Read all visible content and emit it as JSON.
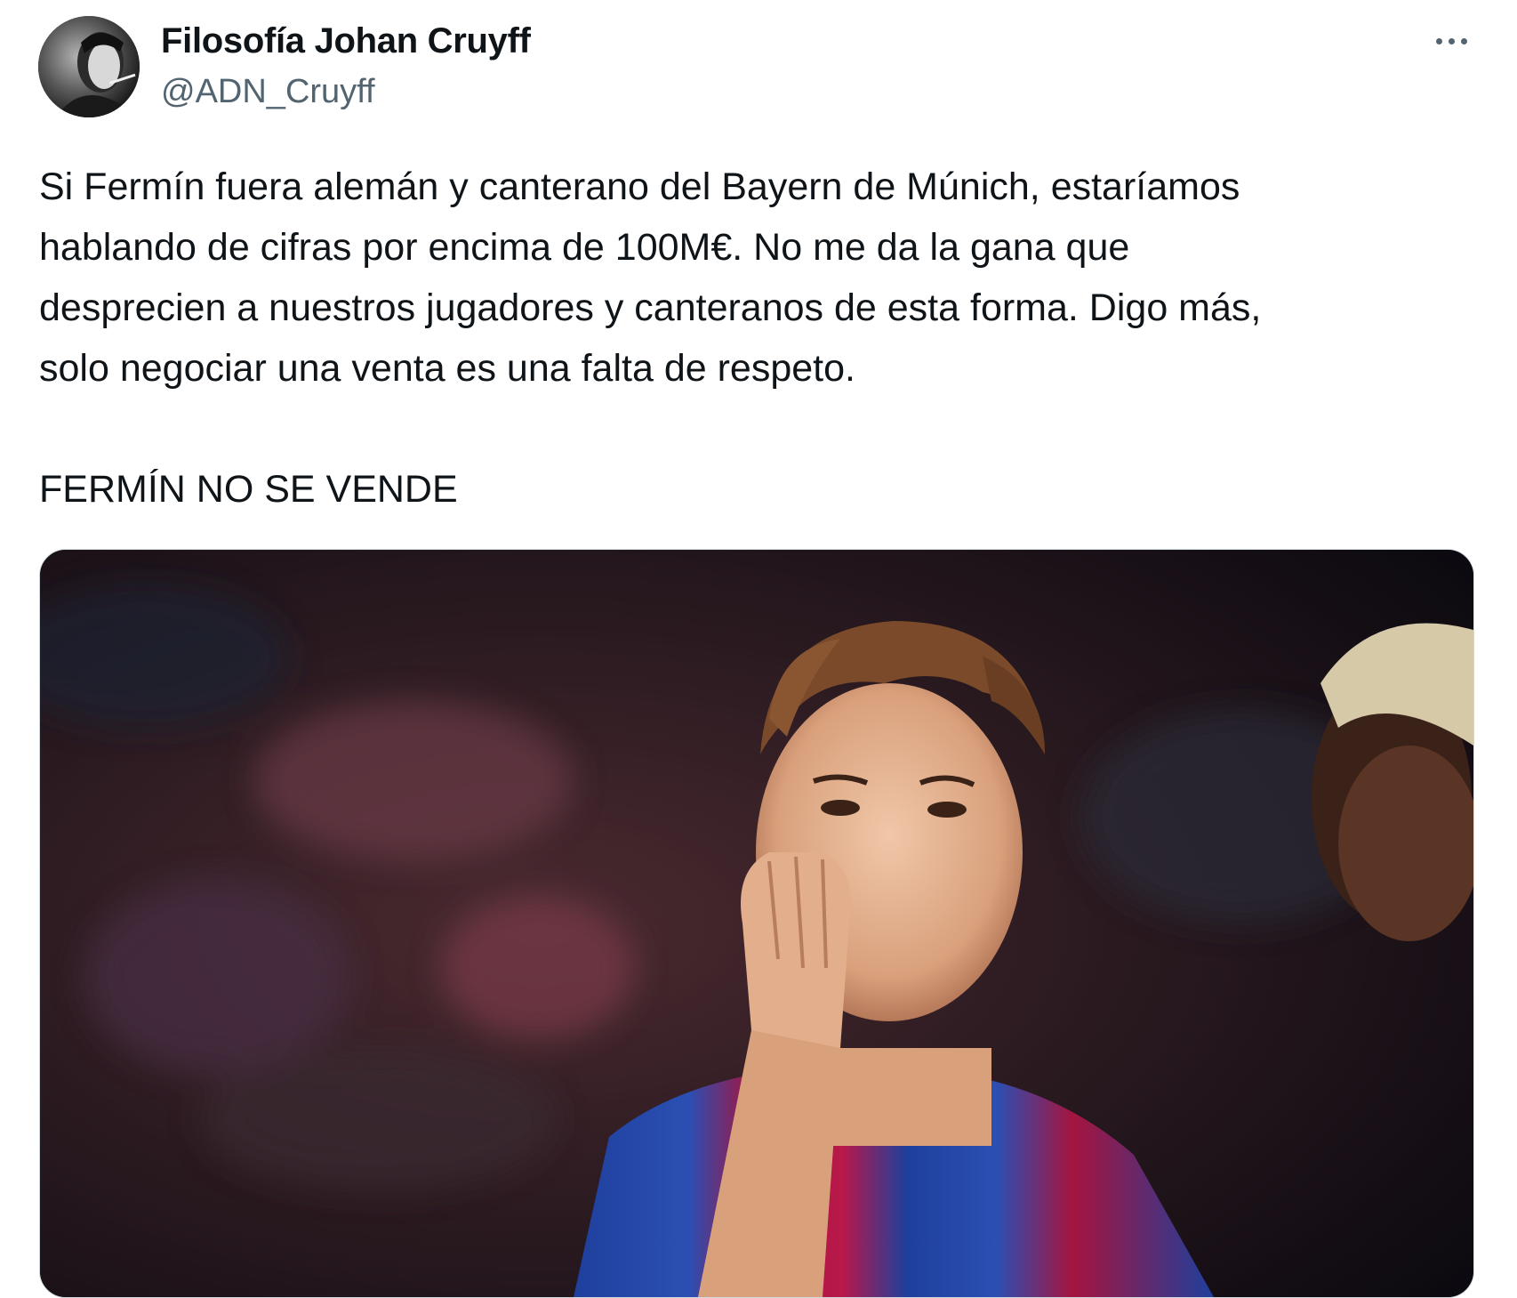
{
  "author": {
    "display_name": "Filosofía Johan Cruyff",
    "handle": "@ADN_Cruyff",
    "avatar_icon": "profile-photo"
  },
  "more_icon": "more-horizontal-icon",
  "tweet": {
    "lines": [
      "Si Fermín fuera alemán y canterano del Bayern de Múnich, estaríamos",
      "hablando de cifras por encima de 100M€. No me da la gana que",
      "desprecien a nuestros jugadores y canteranos de esta forma. Digo más,",
      "solo negociar una venta es una falta de respeto.",
      "FERMÍN NO SE VENDE"
    ]
  },
  "media": {
    "kind": "photo",
    "subject": "football-player-blowing-kiss"
  },
  "colors": {
    "text_primary": "#0f1419",
    "text_secondary": "#536471",
    "border": "#cfd9de",
    "kit_blue": "#1f3f9c",
    "kit_red": "#a5143f"
  }
}
